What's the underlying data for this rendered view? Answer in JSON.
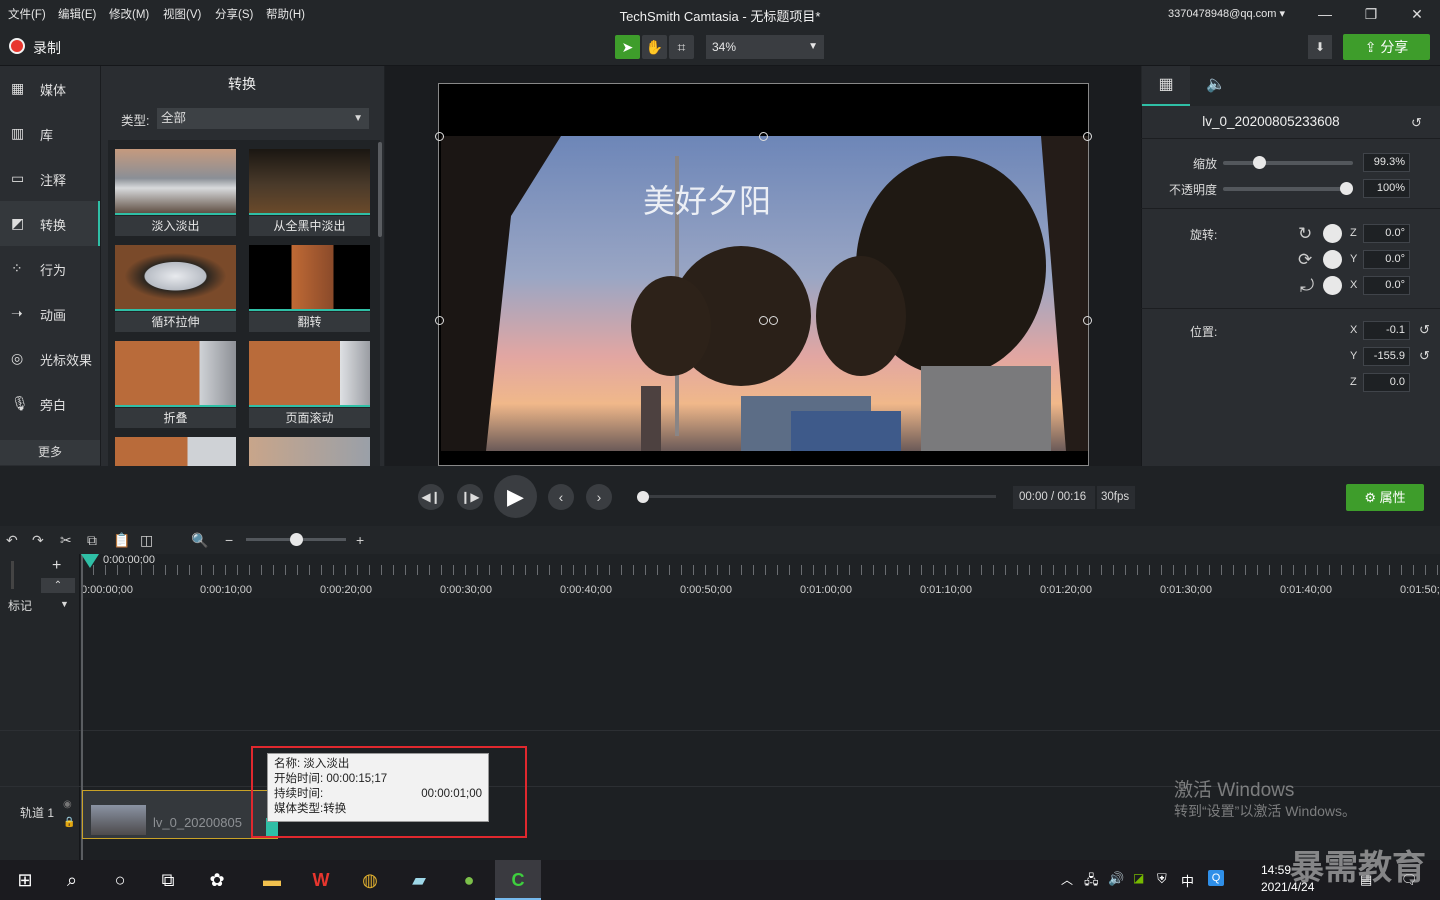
{
  "menu": [
    "文件(F)",
    "编辑(E)",
    "修改(M)",
    "视图(V)",
    "分享(S)",
    "帮助(H)"
  ],
  "window_title": "TechSmith Camtasia - 无标题项目*",
  "account": "3370478948@qq.com ▾",
  "toolbar": {
    "record": "录制",
    "zoom": "34%",
    "share": "分享"
  },
  "nav": [
    "媒体",
    "库",
    "注释",
    "转换",
    "行为",
    "动画",
    "光标效果",
    "旁白"
  ],
  "nav_more": "更多",
  "panel": {
    "title": "转换",
    "type_label": "类型:",
    "type_value": "全部"
  },
  "thumbs": [
    "淡入淡出",
    "从全黑中淡出",
    "循环拉伸",
    "翻转",
    "折叠",
    "页面滚动"
  ],
  "canvas_text": "美好夕阳",
  "props": {
    "clip_name": "lv_0_20200805233608",
    "scale_label": "缩放",
    "scale_value": "99.3%",
    "scale_frac": 0.993,
    "opacity_label": "不透明度",
    "opacity_value": "100%",
    "opacity_frac": 1.0,
    "rotation_label": "旋转:",
    "rot_z": "0.0°",
    "rot_y": "0.0°",
    "rot_x": "0.0°",
    "position_label": "位置:",
    "pos_x": "-0.1",
    "pos_y": "-155.9",
    "pos_z": "0.0",
    "axis_z": "Z",
    "axis_y": "Y",
    "axis_x": "X"
  },
  "playback": {
    "time": "00:00 / 00:16",
    "fps": "30fps",
    "attr": "属性"
  },
  "timeline": {
    "playhead_time": "0:00:00;00",
    "ticks": [
      "0:00:00;00",
      "0:00:10;00",
      "0:00:20;00",
      "0:00:30;00",
      "0:00:40;00",
      "0:00:50;00",
      "0:01:00;00",
      "0:01:10;00",
      "0:01:20;00",
      "0:01:30;00",
      "0:01:40;00",
      "0:01:50;"
    ],
    "marker": "标记",
    "track": "轨道 1",
    "clip_label": "lv_0_20200805"
  },
  "tooltip": {
    "name": "名称: 淡入淡出",
    "start": "开始时间: 00:00:15;17",
    "duration_label": "持续时间:",
    "duration": "00:00:01;00",
    "type": "媒体类型:转换"
  },
  "activate": {
    "title": "激活 Windows",
    "sub": "转到“设置”以激活 Windows。"
  },
  "tray": {
    "time": "14:59",
    "date": "2021/4/24",
    "ime": "中"
  },
  "watermark": "暴需教育"
}
